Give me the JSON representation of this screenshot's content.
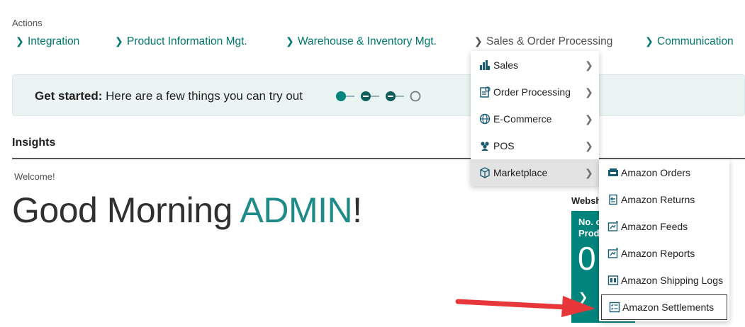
{
  "actions": {
    "label": "Actions",
    "items": [
      {
        "label": "Integration"
      },
      {
        "label": "Product Information Mgt."
      },
      {
        "label": "Warehouse & Inventory Mgt."
      },
      {
        "label": "Sales & Order Processing"
      },
      {
        "label": "Communication"
      }
    ]
  },
  "banner": {
    "bold": "Get started:",
    "text": " Here are a few things you can try out",
    "progress_steps": 4,
    "completed_steps": 3
  },
  "insights": {
    "title": "Insights"
  },
  "welcome": {
    "label": "Welcome!",
    "greeting_prefix": "Good Morning ",
    "user": "ADMIN",
    "greeting_suffix": "!"
  },
  "webshop": {
    "title_partial": "Websh",
    "tile_label_line1": "No. c",
    "tile_label_line2": "Prod",
    "tile_value": "0"
  },
  "menu": {
    "items": [
      {
        "label": "Sales",
        "icon": "sales-icon"
      },
      {
        "label": "Order Processing",
        "icon": "order-processing-icon"
      },
      {
        "label": "E-Commerce",
        "icon": "globe-icon"
      },
      {
        "label": "POS",
        "icon": "people-icon"
      },
      {
        "label": "Marketplace",
        "icon": "marketplace-icon"
      }
    ]
  },
  "submenu": {
    "items": [
      {
        "label": "Amazon Orders",
        "icon": "orders-icon"
      },
      {
        "label": "Amazon Returns",
        "icon": "returns-icon"
      },
      {
        "label": "Amazon Feeds",
        "icon": "feeds-icon"
      },
      {
        "label": "Amazon Reports",
        "icon": "reports-icon"
      },
      {
        "label": "Amazon Shipping Logs",
        "icon": "shipping-logs-icon"
      },
      {
        "label": "Amazon Settlements",
        "icon": "settlements-icon"
      }
    ]
  },
  "colors": {
    "accent": "#00786e",
    "tile": "#00847c",
    "arrow": "#e8373a"
  }
}
